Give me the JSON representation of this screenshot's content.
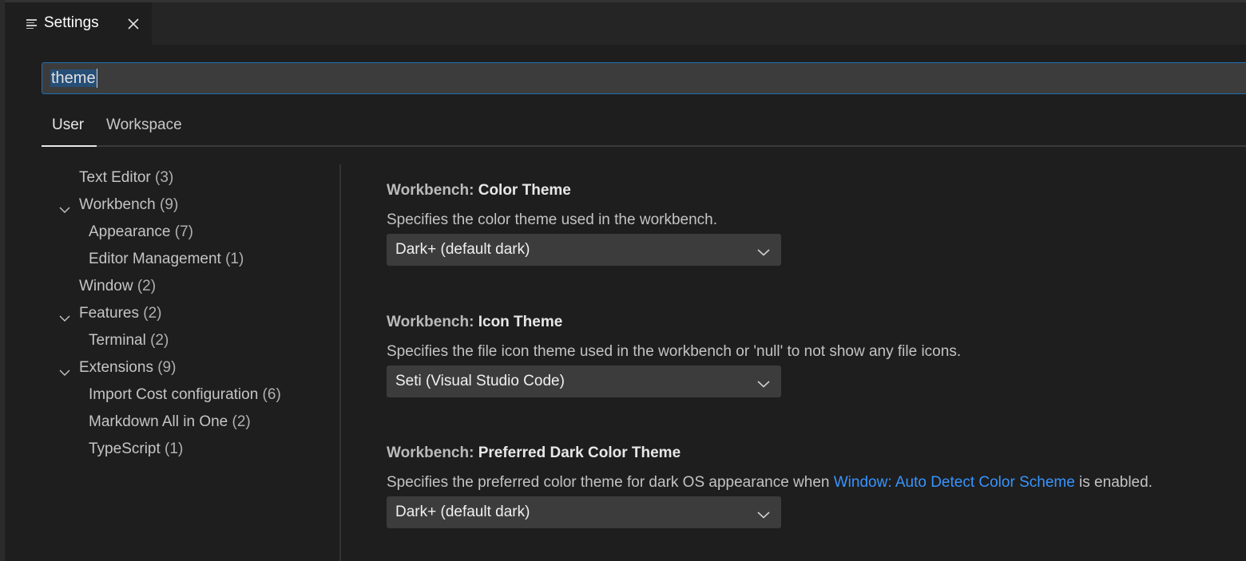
{
  "editor_tab": {
    "icon": "settings-list-icon",
    "title": "Settings",
    "close_icon": "close-icon"
  },
  "search": {
    "value": "theme",
    "placeholder": "Search settings"
  },
  "scope_tabs": [
    {
      "label": "User",
      "active": true
    },
    {
      "label": "Workspace",
      "active": false
    }
  ],
  "toc": [
    {
      "label": "Text Editor",
      "count": "(3)",
      "level": 0,
      "expanded": null
    },
    {
      "label": "Workbench",
      "count": "(9)",
      "level": 0,
      "expanded": true
    },
    {
      "label": "Appearance",
      "count": "(7)",
      "level": 1,
      "expanded": null
    },
    {
      "label": "Editor Management",
      "count": "(1)",
      "level": 1,
      "expanded": null
    },
    {
      "label": "Window",
      "count": "(2)",
      "level": 0,
      "expanded": null
    },
    {
      "label": "Features",
      "count": "(2)",
      "level": 0,
      "expanded": true
    },
    {
      "label": "Terminal",
      "count": "(2)",
      "level": 1,
      "expanded": null
    },
    {
      "label": "Extensions",
      "count": "(9)",
      "level": 0,
      "expanded": true
    },
    {
      "label": "Import Cost configuration",
      "count": "(6)",
      "level": 1,
      "expanded": null
    },
    {
      "label": "Markdown All in One",
      "count": "(2)",
      "level": 1,
      "expanded": null
    },
    {
      "label": "TypeScript",
      "count": "(1)",
      "level": 1,
      "expanded": null
    }
  ],
  "settings": [
    {
      "category": "Workbench: ",
      "name": "Color Theme",
      "description_before": "Specifies the color theme used in the workbench.",
      "link": "",
      "description_after": "",
      "value": "Dark+ (default dark)"
    },
    {
      "category": "Workbench: ",
      "name": "Icon Theme",
      "description_before": "Specifies the file icon theme used in the workbench or 'null' to not show any file icons.",
      "link": "",
      "description_after": "",
      "value": "Seti (Visual Studio Code)"
    },
    {
      "category": "Workbench: ",
      "name": "Preferred Dark Color Theme",
      "description_before": "Specifies the preferred color theme for dark OS appearance when ",
      "link": "Window: Auto Detect Color Scheme",
      "description_after": " is enabled.",
      "value": "Dark+ (default dark)"
    }
  ],
  "colors": {
    "background": "#1e1e1e",
    "input_background": "#3c3c3c",
    "focus_border": "#1f6fb3",
    "selection": "#264f78",
    "link": "#3794ff"
  }
}
